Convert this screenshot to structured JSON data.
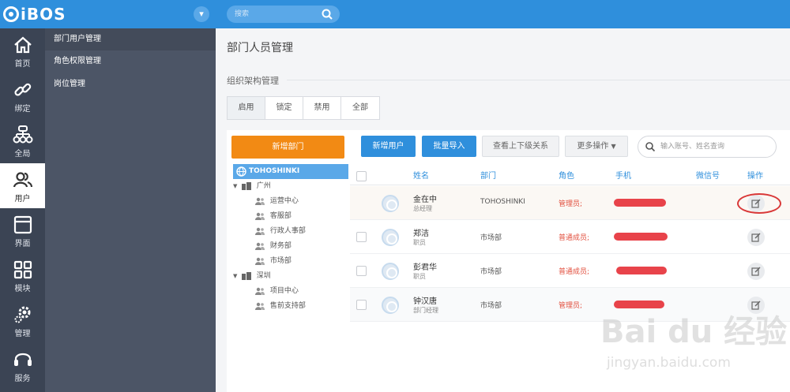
{
  "app": {
    "logo": "iBOS"
  },
  "top_search": {
    "placeholder": "搜索"
  },
  "leftnav": [
    {
      "label": "首页",
      "icon": "home-icon"
    },
    {
      "label": "绑定",
      "icon": "link-icon"
    },
    {
      "label": "全局",
      "icon": "org-icon"
    },
    {
      "label": "用户",
      "icon": "users-icon",
      "active": true
    },
    {
      "label": "界面",
      "icon": "window-icon"
    },
    {
      "label": "模块",
      "icon": "grid-icon"
    },
    {
      "label": "管理",
      "icon": "gear-icon"
    },
    {
      "label": "服务",
      "icon": "headset-icon"
    }
  ],
  "subnav": [
    {
      "label": "部门用户管理",
      "active": true
    },
    {
      "label": "角色权限管理"
    },
    {
      "label": "岗位管理"
    }
  ],
  "page": {
    "title": "部门人员管理",
    "section": "组织架构管理"
  },
  "tabs": [
    "启用",
    "锁定",
    "禁用",
    "全部"
  ],
  "tree": {
    "add_button": "新增部门",
    "root": "TOHOSHINKI",
    "groups": [
      {
        "name": "广州",
        "children": [
          "运营中心",
          "客服部",
          "行政人事部",
          "财务部",
          "市场部"
        ]
      },
      {
        "name": "深圳",
        "children": [
          "项目中心",
          "售前支持部"
        ]
      }
    ]
  },
  "toolbar": {
    "add_user": "新增用户",
    "batch_import": "批量导入",
    "view_hierarchy": "查看上下级关系",
    "more_actions": "更多操作",
    "search_placeholder": "输入账号、姓名查询"
  },
  "table": {
    "headers": [
      "姓名",
      "部门",
      "角色",
      "手机",
      "微信号",
      "操作"
    ],
    "rows": [
      {
        "name": "金在中",
        "title": "总经理",
        "dept": "TOHOSHINKI",
        "role": "管理员;"
      },
      {
        "name": "郑洁",
        "title": "职员",
        "dept": "市场部",
        "role": "普通成员;"
      },
      {
        "name": "彭君华",
        "title": "职员",
        "dept": "市场部",
        "role": "普通成员;"
      },
      {
        "name": "钟汉唐",
        "title": "部门经理",
        "dept": "市场部",
        "role": "管理员;"
      }
    ]
  },
  "watermark": {
    "text": "Bai du 经验",
    "url": "jingyan.baidu.com"
  },
  "colors": {
    "primary": "#2f8fdc",
    "orange": "#f28a14",
    "red": "#e8434a",
    "sidebar": "#3b4454"
  }
}
